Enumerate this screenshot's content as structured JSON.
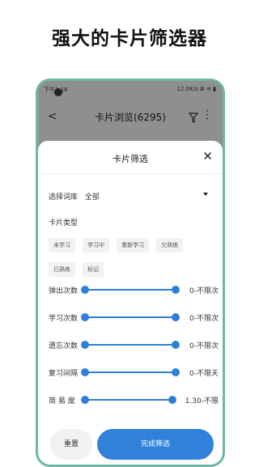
{
  "headline": "强大的卡片筛选器",
  "status": {
    "time": "下午3:16",
    "indicators": "12.0K/s ⊠ ≋ ▮"
  },
  "appbar": {
    "title": "卡片浏览(6295)",
    "back_icon": "back-arrow",
    "filter_icon": "filter-funnel",
    "more_icon": "more-vertical"
  },
  "sheet": {
    "title": "卡片筛选",
    "library": {
      "label": "选择词库",
      "value": "全部"
    },
    "type_label": "卡片类型",
    "chips": [
      "未学习",
      "学习中",
      "重新学习",
      "欠熟练",
      "已熟练",
      "标记"
    ],
    "sliders": [
      {
        "label": "弹出次数",
        "value": "0-不限次"
      },
      {
        "label": "学习次数",
        "value": "0-不限次"
      },
      {
        "label": "遗忘次数",
        "value": "0-不限次"
      },
      {
        "label": "复习间隔",
        "value": "0-不限天"
      },
      {
        "label": "简 易 度",
        "value": "1.30-不限"
      }
    ],
    "reset": "重置",
    "done": "完成筛选"
  }
}
